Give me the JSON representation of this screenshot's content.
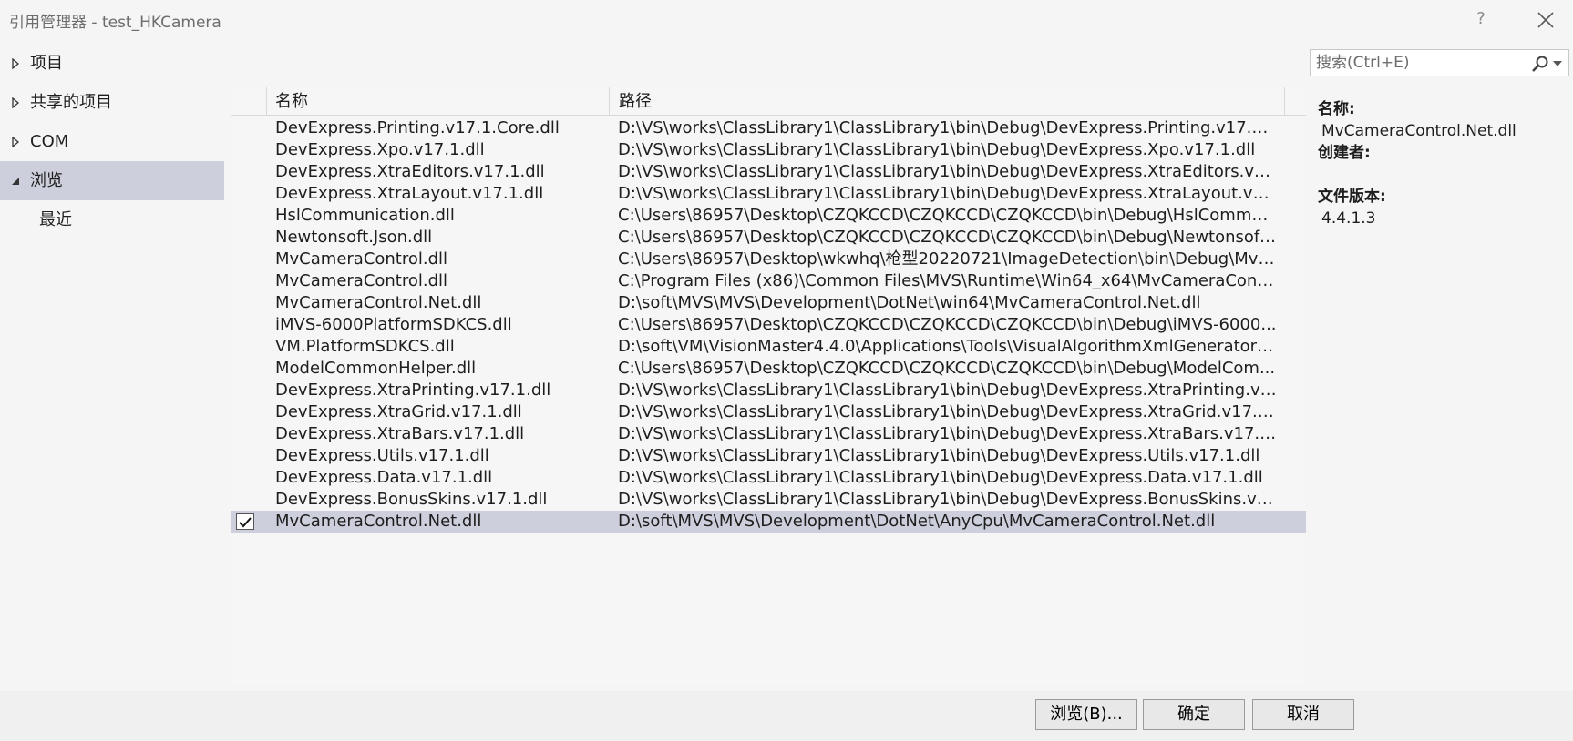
{
  "window": {
    "title": "引用管理器 - test_HKCamera",
    "help_label": "?",
    "icons": {
      "close": "close-icon",
      "help": "help-icon"
    }
  },
  "nav": {
    "items": [
      {
        "label": "项目",
        "caret": "collapsed"
      },
      {
        "label": "共享的项目",
        "caret": "collapsed"
      },
      {
        "label": "COM",
        "caret": "collapsed"
      },
      {
        "label": "浏览",
        "caret": "expanded",
        "selected": true
      },
      {
        "label": "最近",
        "sub": true
      }
    ]
  },
  "search": {
    "placeholder": "搜索(Ctrl+E)",
    "icon": "search-icon"
  },
  "list": {
    "columns": {
      "name": "名称",
      "path": "路径"
    },
    "rows": [
      {
        "name": "DevExpress.Printing.v17.1.Core.dll",
        "path": "D:\\VS\\works\\ClassLibrary1\\ClassLibrary1\\bin\\Debug\\DevExpress.Printing.v17.1.Co..."
      },
      {
        "name": "DevExpress.Xpo.v17.1.dll",
        "path": "D:\\VS\\works\\ClassLibrary1\\ClassLibrary1\\bin\\Debug\\DevExpress.Xpo.v17.1.dll"
      },
      {
        "name": "DevExpress.XtraEditors.v17.1.dll",
        "path": "D:\\VS\\works\\ClassLibrary1\\ClassLibrary1\\bin\\Debug\\DevExpress.XtraEditors.v17.1...."
      },
      {
        "name": "DevExpress.XtraLayout.v17.1.dll",
        "path": "D:\\VS\\works\\ClassLibrary1\\ClassLibrary1\\bin\\Debug\\DevExpress.XtraLayout.v17.1...."
      },
      {
        "name": "HslCommunication.dll",
        "path": "C:\\Users\\86957\\Desktop\\CZQKCCD\\CZQKCCD\\CZQKCCD\\bin\\Debug\\HslCommun..."
      },
      {
        "name": "Newtonsoft.Json.dll",
        "path": "C:\\Users\\86957\\Desktop\\CZQKCCD\\CZQKCCD\\CZQKCCD\\bin\\Debug\\Newtonsoft...."
      },
      {
        "name": "MvCameraControl.dll",
        "path": "C:\\Users\\86957\\Desktop\\wkwhq\\枪型20220721\\ImageDetection\\bin\\Debug\\MvC..."
      },
      {
        "name": "MvCameraControl.dll",
        "path": "C:\\Program Files (x86)\\Common Files\\MVS\\Runtime\\Win64_x64\\MvCameraContro..."
      },
      {
        "name": "MvCameraControl.Net.dll",
        "path": "D:\\soft\\MVS\\MVS\\Development\\DotNet\\win64\\MvCameraControl.Net.dll"
      },
      {
        "name": "iMVS-6000PlatformSDKCS.dll",
        "path": "C:\\Users\\86957\\Desktop\\CZQKCCD\\CZQKCCD\\CZQKCCD\\bin\\Debug\\iMVS-6000..."
      },
      {
        "name": "VM.PlatformSDKCS.dll",
        "path": "D:\\soft\\VM\\VisionMaster4.4.0\\Applications\\Tools\\VisualAlgorithmXmlGenerator\\p..."
      },
      {
        "name": "ModelCommonHelper.dll",
        "path": "C:\\Users\\86957\\Desktop\\CZQKCCD\\CZQKCCD\\CZQKCCD\\bin\\Debug\\ModelCom..."
      },
      {
        "name": "DevExpress.XtraPrinting.v17.1.dll",
        "path": "D:\\VS\\works\\ClassLibrary1\\ClassLibrary1\\bin\\Debug\\DevExpress.XtraPrinting.v17...."
      },
      {
        "name": "DevExpress.XtraGrid.v17.1.dll",
        "path": "D:\\VS\\works\\ClassLibrary1\\ClassLibrary1\\bin\\Debug\\DevExpress.XtraGrid.v17.1.dll"
      },
      {
        "name": "DevExpress.XtraBars.v17.1.dll",
        "path": "D:\\VS\\works\\ClassLibrary1\\ClassLibrary1\\bin\\Debug\\DevExpress.XtraBars.v17.1.dll"
      },
      {
        "name": "DevExpress.Utils.v17.1.dll",
        "path": "D:\\VS\\works\\ClassLibrary1\\ClassLibrary1\\bin\\Debug\\DevExpress.Utils.v17.1.dll"
      },
      {
        "name": "DevExpress.Data.v17.1.dll",
        "path": "D:\\VS\\works\\ClassLibrary1\\ClassLibrary1\\bin\\Debug\\DevExpress.Data.v17.1.dll"
      },
      {
        "name": "DevExpress.BonusSkins.v17.1.dll",
        "path": "D:\\VS\\works\\ClassLibrary1\\ClassLibrary1\\bin\\Debug\\DevExpress.BonusSkins.v17.1...."
      },
      {
        "name": "MvCameraControl.Net.dll",
        "path": "D:\\soft\\MVS\\MVS\\Development\\DotNet\\AnyCpu\\MvCameraControl.Net.dll",
        "selected": true,
        "checked": true
      }
    ]
  },
  "details": {
    "name_label": "名称:",
    "name_value": "MvCameraControl.Net.dll",
    "creator_label": "创建者:",
    "version_label": "文件版本:",
    "version_value": "4.4.1.3"
  },
  "footer": {
    "browse": "浏览(B)...",
    "ok": "确定",
    "cancel": "取消"
  },
  "colors": {
    "selection": "#cdcfdc",
    "background": "#f5f5f5"
  }
}
